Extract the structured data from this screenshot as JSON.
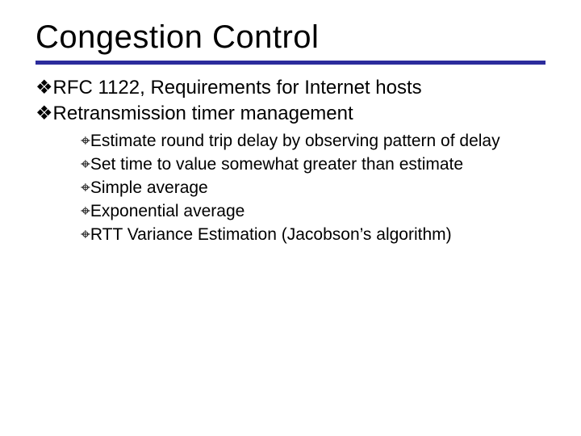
{
  "title": "Congestion Control",
  "bullet_glyph_l1": "❖",
  "bullet_glyph_l2": "⌖",
  "l1": {
    "items": [
      "RFC 1122, Requirements for Internet hosts",
      "Retransmission timer management"
    ]
  },
  "l2": {
    "items": [
      "Estimate round trip delay by observing pattern of delay",
      "Set time to value somewhat greater than estimate",
      "Simple average",
      "Exponential average",
      "RTT Variance Estimation (Jacobson’s algorithm)"
    ]
  }
}
